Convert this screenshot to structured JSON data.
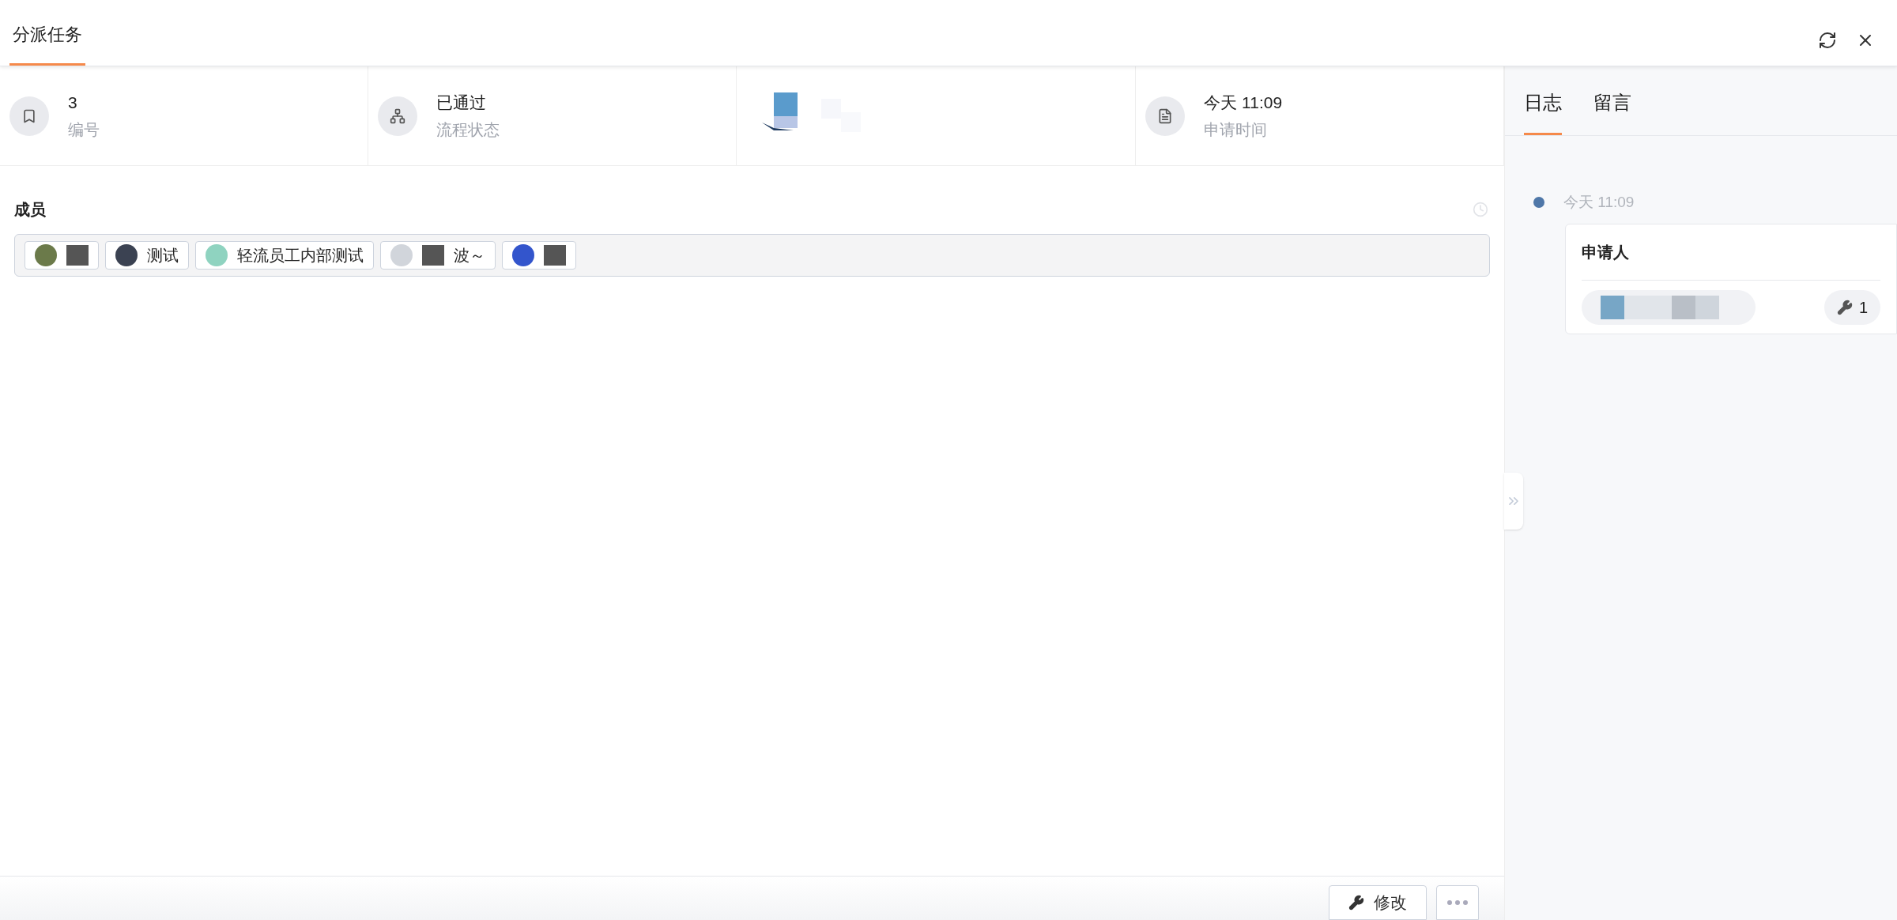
{
  "header": {
    "tabs": [
      {
        "label": "分派任务",
        "selected": true
      }
    ]
  },
  "info": [
    {
      "kind": "number",
      "value": "3",
      "label": "编号"
    },
    {
      "kind": "status",
      "value": "已通过",
      "label": "流程状态"
    },
    {
      "kind": "redacted"
    },
    {
      "kind": "time",
      "value": "今天 11:09",
      "label": "申请时间"
    }
  ],
  "members": {
    "label": "成员",
    "items": [
      {
        "redacted": true,
        "color": "#6b7a4a"
      },
      {
        "name": "测试",
        "redacted": false,
        "color": "#3b4252"
      },
      {
        "name": "轻流员工内部测试",
        "redacted": false,
        "color": "#8fd3c0"
      },
      {
        "name": "波～",
        "redacted": true,
        "color": "#d1d5db"
      },
      {
        "redacted": true,
        "color": "#3355cc"
      }
    ]
  },
  "side": {
    "tabs": [
      {
        "label": "日志",
        "selected": true
      },
      {
        "label": "留言",
        "selected": false
      }
    ],
    "log": [
      {
        "time": "今天 11:09",
        "title": "申请人",
        "count": "1"
      }
    ]
  },
  "footer": {
    "edit": "修改"
  }
}
